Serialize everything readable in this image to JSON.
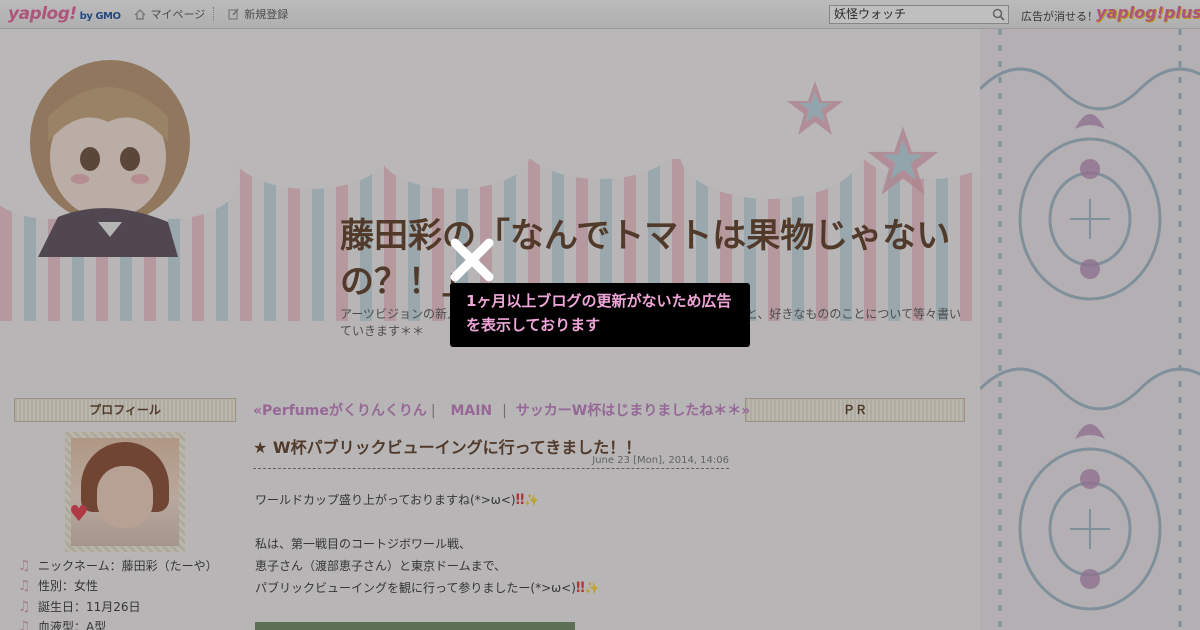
{
  "topbar": {
    "logo": "yaplog!",
    "logo_sub": "by GMO",
    "mypage": "マイページ",
    "signup": "新規登録",
    "search_value": "妖怪ウォッチ",
    "ad_note": "広告が消せる！",
    "plus_logo": "yaplog!plus"
  },
  "header": {
    "title": "藤田彩の「なんでトマトは果物じゃないの？！」",
    "description": "アーツビジョンの新人声優、藤田彩（ふじたあや）のブログです。日々のこと、好きなもののことについて等々書いていきます＊＊"
  },
  "overlay": {
    "message": "1ヶ月以上ブログの更新がないため広告を表示しております"
  },
  "sidebar_left": {
    "heading": "プロフィール",
    "items": [
      {
        "label": "ニックネーム：藤田彩（たーや）"
      },
      {
        "label": "性別：女性"
      },
      {
        "label": "誕生日：11月26日"
      },
      {
        "label": "血液型：A型"
      }
    ]
  },
  "sidebar_right": {
    "heading": "ＰＲ"
  },
  "nav": {
    "prev": "«Perfumeがくりんくりん",
    "main": "MAIN",
    "next": "サッカーW杯はじまりましたね＊＊»"
  },
  "post": {
    "title": "★ W杯パブリックビューイングに行ってきました！！",
    "date": "June 23 [Mon], 2014, 14:06",
    "lines": [
      "ワールドカップ盛り上がっておりますね(*>ω<)",
      "",
      "私は、第一戦目のコートジボワール戦、",
      "恵子さん（渡部恵子さん）と東京ドームまで、",
      "パブリックビューイングを観に行って参りましたー(*>ω<)"
    ],
    "emoji_red": "‼",
    "emoji_star": "✨"
  },
  "colors": {
    "title_brown": "#5b3a22",
    "nav_purple": "#c27cc4",
    "popup_text": "#f0a6d8"
  }
}
